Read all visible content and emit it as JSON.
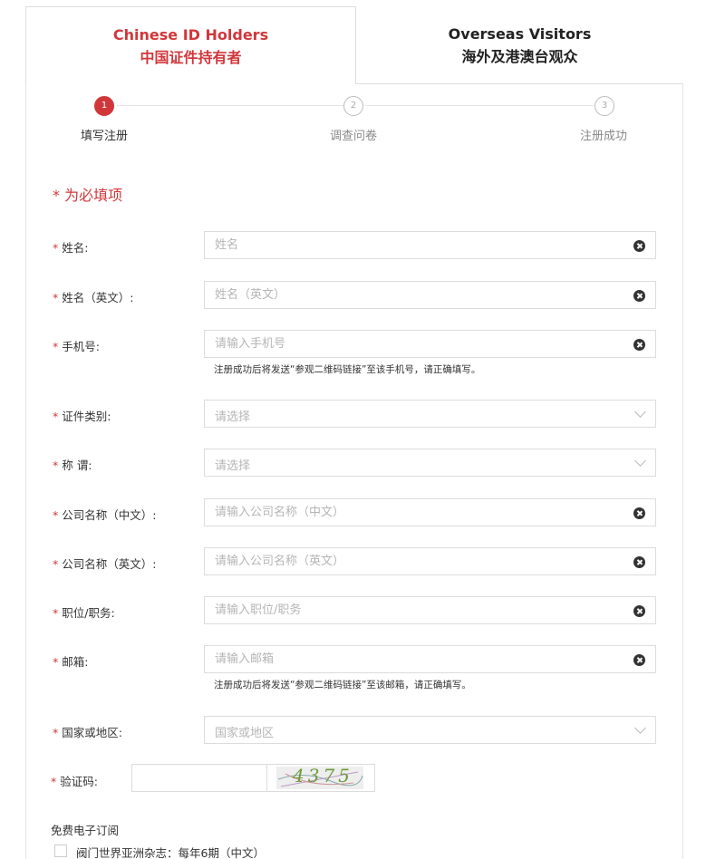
{
  "tabs": [
    {
      "line1": "Chinese ID Holders",
      "line2": "中国证件持有者",
      "active": true
    },
    {
      "line1": "Overseas Visitors",
      "line2": "海外及港澳台观众",
      "active": false
    }
  ],
  "steps": [
    {
      "num": "1",
      "label": "填写注册"
    },
    {
      "num": "2",
      "label": "调查问卷"
    },
    {
      "num": "3",
      "label": "注册成功"
    }
  ],
  "required_note": "* 为必填项",
  "form": {
    "name": {
      "label": "姓名:",
      "placeholder": "姓名"
    },
    "name_en": {
      "label": "姓名（英文）:",
      "placeholder": "姓名（英文）"
    },
    "mobile": {
      "label": "手机号:",
      "placeholder": "请输入手机号",
      "hint": "注册成功后将发送“参观二维码链接”至该手机号，请正确填写。"
    },
    "id_type": {
      "label": "证件类别:",
      "placeholder": "请选择"
    },
    "title": {
      "label": "称 谓:",
      "placeholder": "请选择"
    },
    "company_cn": {
      "label": "公司名称（中文）:",
      "placeholder": "请输入公司名称（中文）"
    },
    "company_en": {
      "label": "公司名称（英文）:",
      "placeholder": "请输入公司名称（英文）"
    },
    "position": {
      "label": "职位/职务:",
      "placeholder": "请输入职位/职务"
    },
    "email": {
      "label": "邮箱:",
      "placeholder": "请输入邮箱",
      "hint": "注册成功后将发送“参观二维码链接”至该邮箱，请正确填写。"
    },
    "country": {
      "label": "国家或地区:",
      "placeholder": "国家或地区"
    },
    "captcha": {
      "label": "验证码:",
      "image_text": "4375"
    }
  },
  "subscribe": {
    "title": "免费电子订阅",
    "item": "阀门世界亚洲杂志：每年6期（中文）"
  },
  "colors": {
    "accent": "#d0373b"
  }
}
